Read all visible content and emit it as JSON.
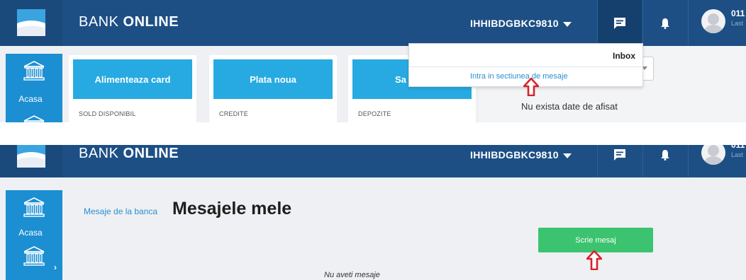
{
  "brand": {
    "prefix": "BANK ",
    "name": "ONLINE"
  },
  "header": {
    "user_code": "IHHIBDGBKC9810",
    "user_id": "011",
    "last_login_label": "Last"
  },
  "sidebar": {
    "home_label": "Acasa"
  },
  "shot1": {
    "cards": [
      {
        "button": "Alimenteaza card",
        "label": "SOLD DISPONIBIL"
      },
      {
        "button": "Plata noua",
        "label": "CREDITE"
      },
      {
        "button": "Sa",
        "label": "DEPOZITE"
      }
    ],
    "inbox": {
      "title": "Inbox",
      "link": "Intra in sectiunea de mesaje"
    },
    "no_data": "Nu exista date de afisat"
  },
  "shot2": {
    "breadcrumb": "Mesaje de la banca",
    "title": "Mesajele mele",
    "write_button": "Scrie mesaj",
    "empty": "Nu aveti mesaje"
  },
  "colors": {
    "header_bg": "#1d4f85",
    "sidebar_bg": "#1b8fd2",
    "card_button": "#27aae1",
    "write_button": "#3cc36f",
    "link": "#2a8fd0",
    "arrow": "#d6242a"
  },
  "icons": [
    "bank-logo-icon",
    "chat-icon",
    "bell-icon",
    "user-avatar-icon",
    "bank-building-icon",
    "chevron-down-icon",
    "red-arrow-up-icon"
  ]
}
